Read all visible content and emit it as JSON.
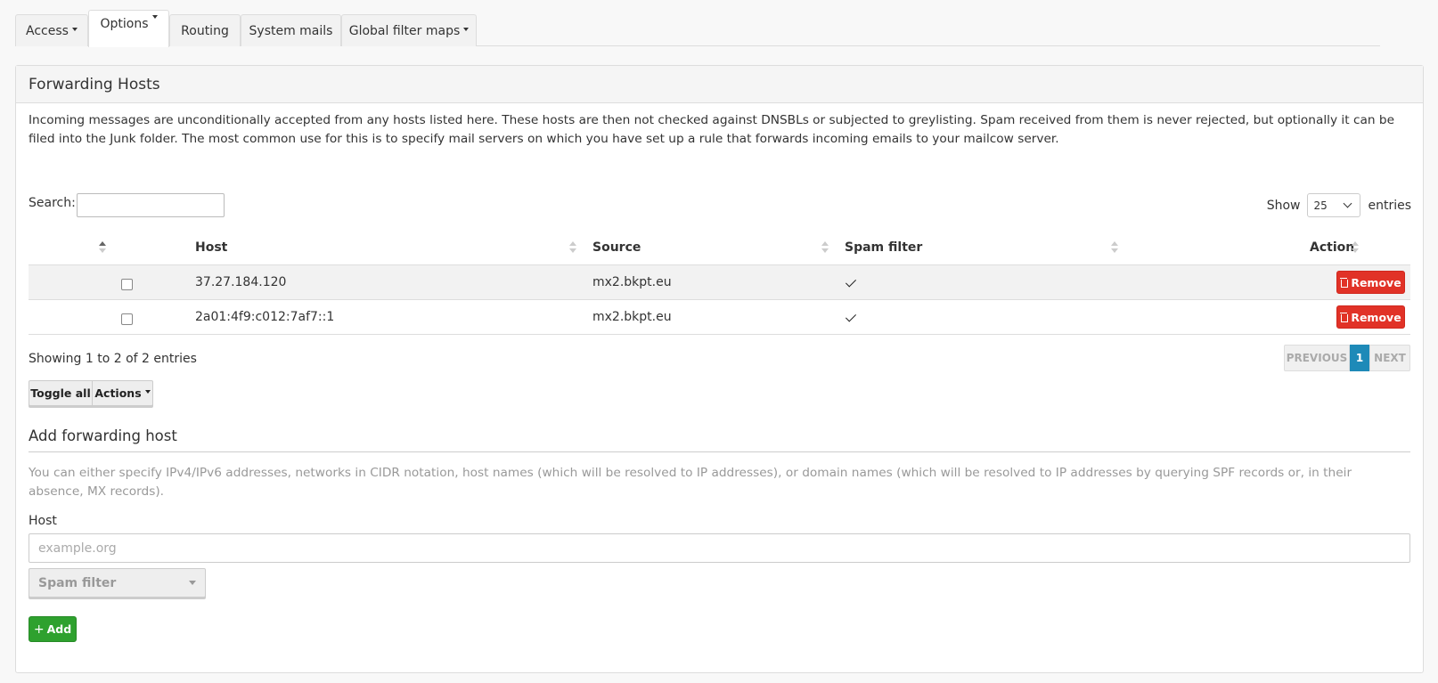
{
  "tabs": [
    {
      "label": "Access",
      "dropdown": true
    },
    {
      "label": "Options",
      "dropdown": true,
      "active": true
    },
    {
      "label": "Routing",
      "dropdown": false
    },
    {
      "label": "System mails",
      "dropdown": false
    },
    {
      "label": "Global filter maps",
      "dropdown": true
    }
  ],
  "panel": {
    "title": "Forwarding Hosts",
    "description": "Incoming messages are unconditionally accepted from any hosts listed here. These hosts are then not checked against DNSBLs or subjected to greylisting. Spam received from them is never rejected, but optionally it can be filed into the Junk folder. The most common use for this is to specify mail servers on which you have set up a rule that forwards incoming emails to your mailcow server."
  },
  "table": {
    "search_label": "Search:",
    "search_value": "",
    "show_label": "Show",
    "page_size": "25",
    "entries_label": "entries",
    "columns": [
      "Host",
      "Source",
      "Spam filter",
      "Action"
    ],
    "rows": [
      {
        "host": "37.27.184.120",
        "source": "mx2.bkpt.eu",
        "spam_filter": true,
        "action": "Remove"
      },
      {
        "host": "2a01:4f9:c012:7af7::1",
        "source": "mx2.bkpt.eu",
        "spam_filter": true,
        "action": "Remove"
      }
    ],
    "info": "Showing 1 to 2 of 2 entries",
    "pager": {
      "previous": "PREVIOUS",
      "current": "1",
      "next": "NEXT"
    },
    "toggle_all": "Toggle all",
    "actions": "Actions"
  },
  "add_form": {
    "title": "Add forwarding host",
    "help": "You can either specify IPv4/IPv6 addresses, networks in CIDR notation, host names (which will be resolved to IP addresses), or domain names (which will be resolved to IP addresses by querying SPF records or, in their absence, MX records).",
    "host_label": "Host",
    "host_placeholder": "example.org",
    "spam_filter_label": "Spam filter",
    "add_button": "Add"
  },
  "colors": {
    "remove": "#e13227",
    "add": "#2ea12e",
    "pager_active": "#1e8ab8"
  },
  "icons": [
    "trash-icon",
    "plus-icon",
    "check-icon",
    "caret-down-icon",
    "sort-icon"
  ]
}
